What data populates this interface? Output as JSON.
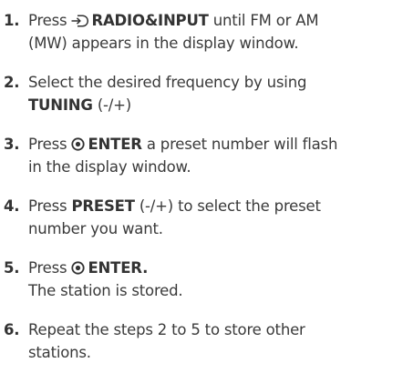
{
  "steps": [
    {
      "number": "1.",
      "pre": "Press",
      "icon": "input-source-icon",
      "bold": "RADIO&INPUT",
      "post": "until FM or AM",
      "line2": "(MW) appears in the display window."
    },
    {
      "number": "2.",
      "line1": "Select the desired frequency by using",
      "bold": "TUNING",
      "post": "(-/+)"
    },
    {
      "number": "3.",
      "pre": "Press",
      "icon": "enter-icon",
      "bold": "ENTER",
      "post": "a preset number will flash",
      "line2": "in the display window."
    },
    {
      "number": "4.",
      "pre": "Press",
      "bold": "PRESET",
      "post": "(-/+) to select the preset",
      "line2": "number you want."
    },
    {
      "number": "5.",
      "pre": "Press",
      "icon": "enter-icon",
      "bold": "ENTER",
      "post": ".",
      "line2": "The station is stored."
    },
    {
      "number": "6.",
      "line1": "Repeat the steps 2 to 5 to store other",
      "line2": "stations."
    }
  ]
}
